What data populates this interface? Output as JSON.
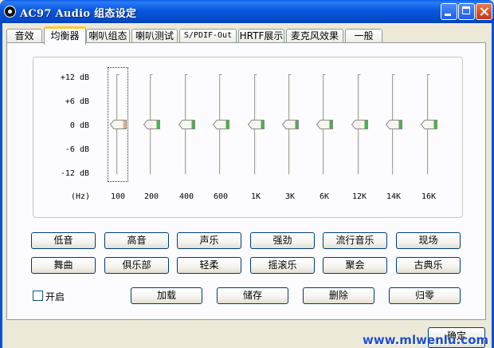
{
  "window": {
    "title": "AC97 Audio 组态设定"
  },
  "tabs": [
    "音效",
    "均衡器",
    "喇叭组态",
    "喇叭测试",
    "S/PDIF-Out",
    "HRTF展示",
    "麦克风效果",
    "一般"
  ],
  "active_tab": "均衡器",
  "equalizer": {
    "db_labels": [
      "+12 dB",
      "+6 dB",
      "0 dB",
      "-6 dB",
      "-12 dB"
    ],
    "unit_label": "(Hz)",
    "bands": [
      "100",
      "200",
      "400",
      "600",
      "1K",
      "3K",
      "6K",
      "12K",
      "14K",
      "16K"
    ],
    "gains_db": [
      0,
      0,
      0,
      0,
      0,
      0,
      0,
      0,
      0,
      0
    ],
    "selected_band": "100",
    "colors": {
      "thumb_selected": "#e8b070",
      "thumb_normal": "#4cb04c"
    }
  },
  "presets": {
    "row1": [
      "低音",
      "高音",
      "声乐",
      "强劲",
      "流行音乐",
      "现场"
    ],
    "row2": [
      "舞曲",
      "俱乐部",
      "轻柔",
      "摇滚乐",
      "聚会",
      "古典乐"
    ]
  },
  "enable": {
    "label": "开启",
    "checked": false
  },
  "actions": [
    "加载",
    "储存",
    "删除",
    "归零"
  ],
  "ok_label": "确定",
  "watermark": "www.mlwenlu.com"
}
